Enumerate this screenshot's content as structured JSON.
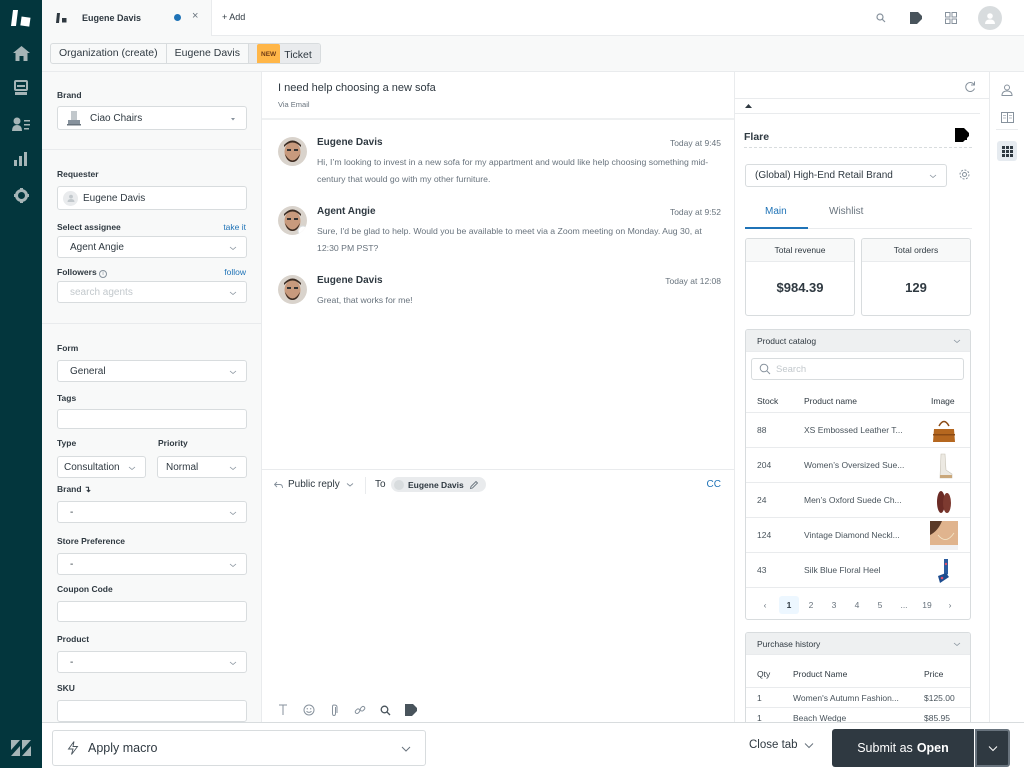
{
  "topbar": {
    "tab_title": "Eugene Davis",
    "add_label": "Add",
    "icons": [
      "search-icon",
      "flare-app-icon",
      "apps-grid-icon",
      "user-avatar-icon"
    ]
  },
  "breadcrumb": {
    "items": [
      "Organization (create)",
      "Eugene Davis",
      "Ticket"
    ],
    "new_badge": "NEW"
  },
  "nav": {
    "icons": [
      "home-icon",
      "views-icon",
      "customers-icon",
      "reporting-icon",
      "admin-gear-icon"
    ]
  },
  "ticket_fields": {
    "brand_label": "Brand",
    "brand_value": "Ciao Chairs",
    "requester_label": "Requester",
    "requester_value": "Eugene Davis",
    "assignee_label": "Select assignee",
    "assignee_link": "take it",
    "assignee_value": "Agent Angie",
    "followers_label": "Followers",
    "followers_link": "follow",
    "followers_placeholder": "search agents",
    "form_label": "Form",
    "form_value": "General",
    "tags_label": "Tags",
    "tags_value": "",
    "type_label": "Type",
    "type_value": "Consultation",
    "priority_label": "Priority",
    "priority_value": "Normal",
    "brand2_label": "Brand ↴",
    "brand2_value": "-",
    "store_pref_label": "Store Preference",
    "store_pref_value": "-",
    "coupon_label": "Coupon Code",
    "coupon_value": "",
    "product_label": "Product",
    "product_value": "-",
    "sku_label": "SKU",
    "sku_value": ""
  },
  "conversation": {
    "subject": "I need help choosing a new sofa",
    "channel": "Via Email",
    "messages": [
      {
        "author": "Eugene Davis",
        "time": "Today at 9:45",
        "body": "Hi, I’m looking to invest in a new sofa for my appartment and would like help choosing something mid-century that would go with my other furniture."
      },
      {
        "author": "Agent Angie",
        "time": "Today at 9:52",
        "body": "Sure, I'd be glad to help. Would you be available to meet via a Zoom meeting on Monday. Aug 30, at 12:30 PM PST?"
      },
      {
        "author": "Eugene Davis",
        "time": "Today at 12:08",
        "body": "Great, that works for me!"
      }
    ],
    "reply_type": "Public reply",
    "to_label": "To",
    "recipient": "Eugene Davis",
    "cc_label": "CC",
    "composer_tools": [
      "text-format-icon",
      "emoji-icon",
      "attachment-icon",
      "link-icon",
      "search-icon",
      "flare-app-icon"
    ]
  },
  "flare": {
    "title": "Flare",
    "brand_select": "(Global) High-End Retail Brand",
    "tabs": [
      "Main",
      "Wishlist"
    ],
    "active_tab": "Main",
    "stats": [
      {
        "label": "Total revenue",
        "value": "$984.39"
      },
      {
        "label": "Total orders",
        "value": "129"
      }
    ],
    "catalog": {
      "title": "Product catalog",
      "search_placeholder": "Search",
      "columns": [
        "Stock",
        "Product name",
        "Image"
      ],
      "rows": [
        {
          "stock": "88",
          "name": "XS Embossed Leather T...",
          "image": "brown-leather-bag"
        },
        {
          "stock": "204",
          "name": "Women’s Oversized Sue...",
          "image": "white-sneaker"
        },
        {
          "stock": "24",
          "name": "Men’s Oxford Suede Ch...",
          "image": "brown-oxford-shoes"
        },
        {
          "stock": "124",
          "name": "Vintage Diamond Neckl...",
          "image": "necklace-model"
        },
        {
          "stock": "43",
          "name": "Silk Blue Floral Heel",
          "image": "blue-floral-heel"
        }
      ],
      "pages": [
        "1",
        "2",
        "3",
        "4",
        "5",
        "...",
        "19"
      ],
      "current_page": "1"
    },
    "purchase_history": {
      "title": "Purchase history",
      "columns": [
        "Qty",
        "Product Name",
        "Price"
      ],
      "rows": [
        {
          "qty": "1",
          "name": "Women's Autumn Fashion...",
          "price": "$125.00"
        },
        {
          "qty": "1",
          "name": "Beach Wedge",
          "price": "$85.95"
        }
      ]
    }
  },
  "rail": {
    "icons": [
      "user-profile-icon",
      "knowledge-book-icon",
      "apps-icon"
    ],
    "active": "apps-icon"
  },
  "footer": {
    "macro_label": "Apply macro",
    "close_tab_label": "Close tab",
    "submit_prefix": "Submit as",
    "submit_status": "Open"
  },
  "colors": {
    "nav_bg": "#03363d",
    "accent_blue": "#1f73b7",
    "submit_bg": "#2f3941",
    "new_badge": "#ffb648"
  }
}
